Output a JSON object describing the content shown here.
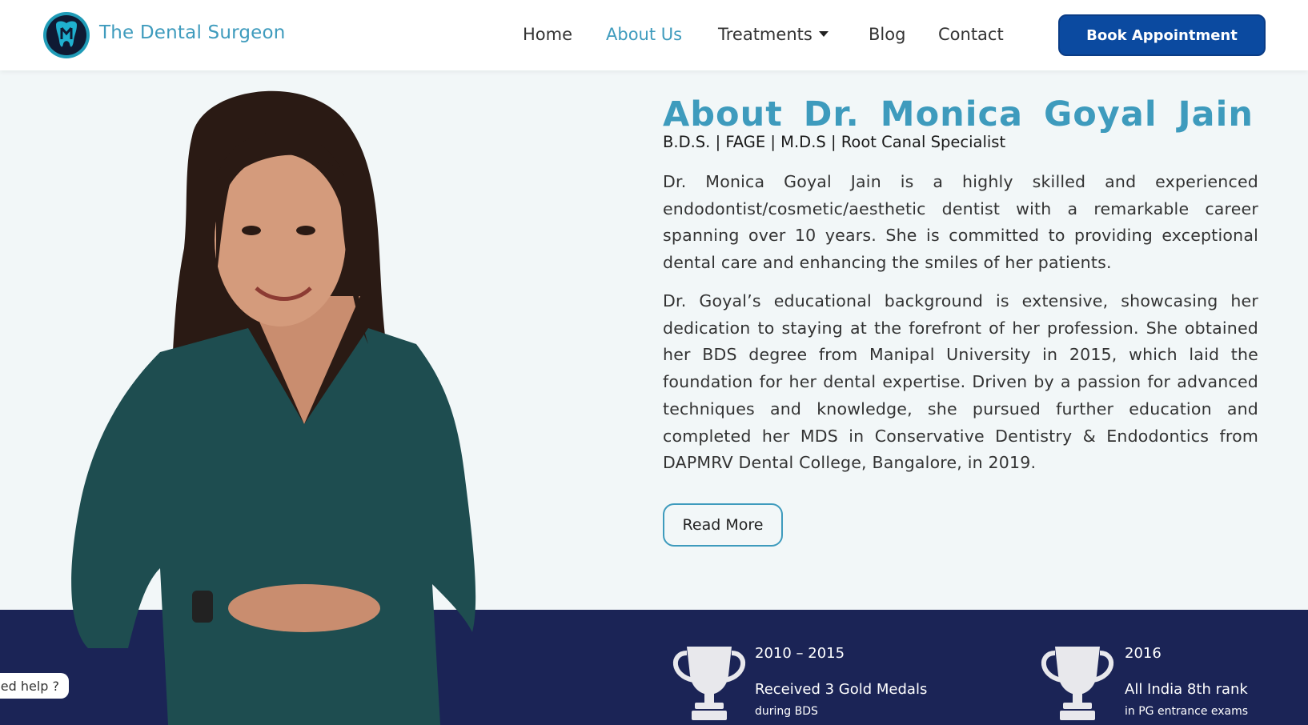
{
  "header": {
    "brand": "The Dental Surgeon",
    "nav": [
      {
        "label": "Home",
        "active": false
      },
      {
        "label": "About Us",
        "active": true
      },
      {
        "label": "Treatments",
        "active": false,
        "has_dropdown": true
      },
      {
        "label": "Blog",
        "active": false
      },
      {
        "label": "Contact",
        "active": false
      }
    ],
    "cta_label": "Book Appointment"
  },
  "about": {
    "title": "About Dr. Monica Goyal Jain",
    "credentials": "B.D.S. | FAGE | M.D.S | Root Canal Specialist",
    "paragraph_1": "Dr. Monica Goyal Jain is a highly skilled and experienced endodontist/cosmetic/aesthetic dentist with a remarkable career spanning over 10 years. She is committed to providing exceptional dental care and enhancing the smiles of her patients.",
    "paragraph_2": "Dr. Goyal’s educational background is extensive, showcasing her dedication to staying at the forefront of her profession. She obtained her BDS degree from Manipal University in 2015, which laid the foundation for her dental expertise. Driven by a passion for advanced techniques and knowledge, she pursued further education and completed her MDS in Conservative Dentistry & Endodontics from DAPMRV Dental College, Bangalore, in 2019.",
    "read_more_label": "Read More"
  },
  "awards": [
    {
      "year": "2010 – 2015",
      "title": "Received 3 Gold Medals",
      "subtitle": "during BDS",
      "icon": "trophy-icon"
    },
    {
      "year": "2016",
      "title": "All India 8th rank",
      "subtitle": "in PG entrance exams",
      "icon": "trophy-icon"
    }
  ],
  "help_chip": "ed help ?",
  "colors": {
    "accent": "#3e9bbd",
    "cta": "#0b4aa0",
    "band": "#1b2456",
    "background": "#f2f7f8"
  }
}
